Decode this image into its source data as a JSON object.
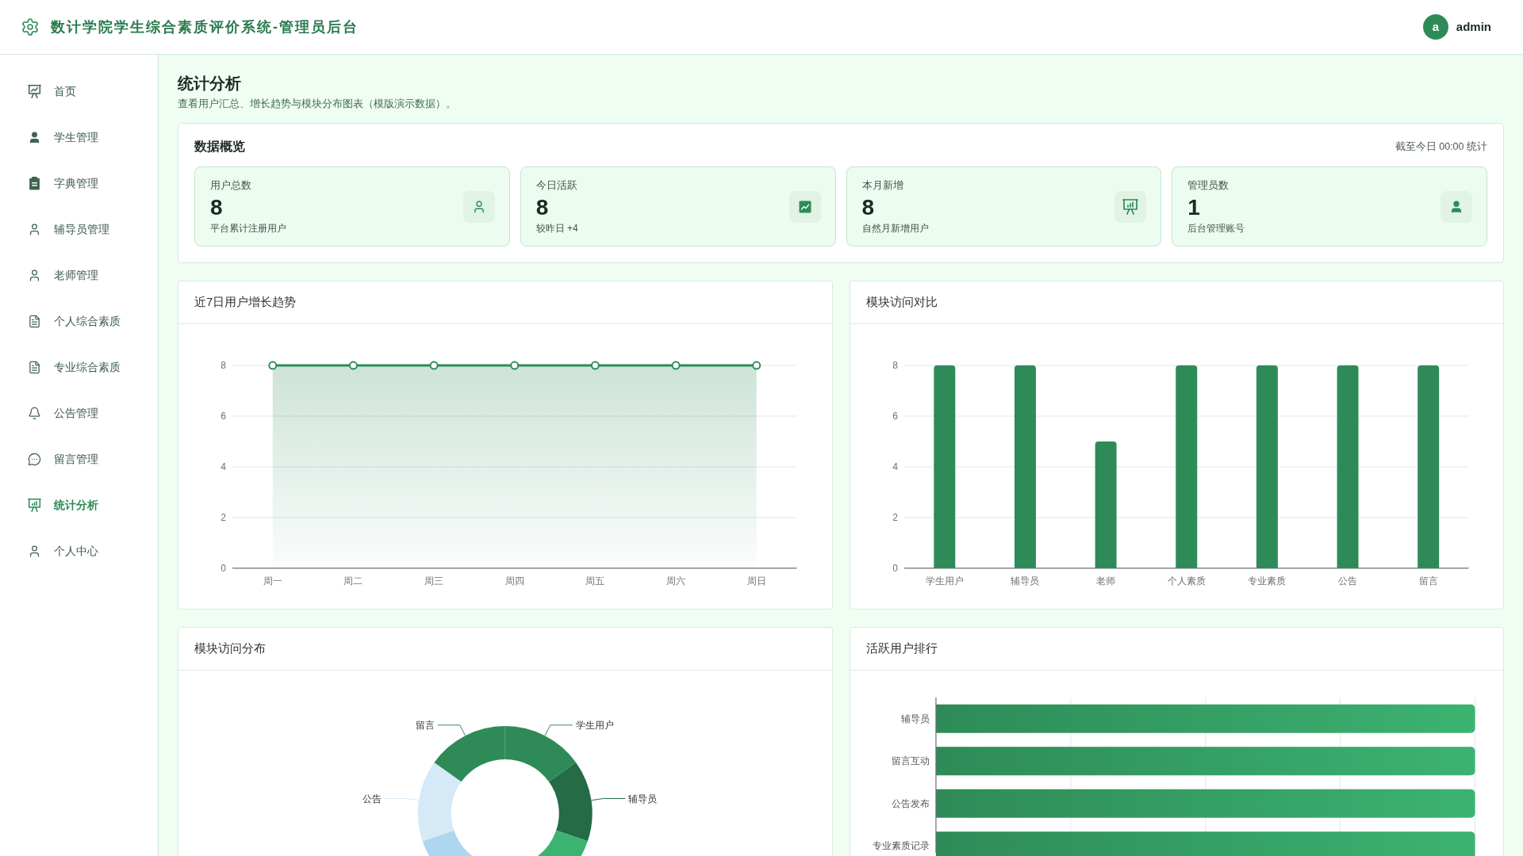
{
  "header": {
    "title": "数计学院学生综合素质评价系统-管理员后台",
    "user": {
      "initial": "a",
      "name": "admin"
    }
  },
  "sidebar": {
    "items": [
      {
        "label": "首页",
        "selected": false
      },
      {
        "label": "学生管理",
        "selected": false
      },
      {
        "label": "字典管理",
        "selected": false
      },
      {
        "label": "辅导员管理",
        "selected": false
      },
      {
        "label": "老师管理",
        "selected": false
      },
      {
        "label": "个人综合素质",
        "selected": false
      },
      {
        "label": "专业综合素质",
        "selected": false
      },
      {
        "label": "公告管理",
        "selected": false
      },
      {
        "label": "留言管理",
        "selected": false
      },
      {
        "label": "统计分析",
        "selected": true
      },
      {
        "label": "个人中心",
        "selected": false
      }
    ]
  },
  "page": {
    "title": "统计分析",
    "subtitle": "查看用户汇总、增长趋势与模块分布图表（模版演示数据）。"
  },
  "overview": {
    "title": "数据概览",
    "note": "截至今日 00:00 统计",
    "stats": [
      {
        "label": "用户总数",
        "value": "8",
        "caption": "平台累计注册用户"
      },
      {
        "label": "今日活跃",
        "value": "8",
        "caption": "较昨日 +4"
      },
      {
        "label": "本月新增",
        "value": "8",
        "caption": "自然月新增用户"
      },
      {
        "label": "管理员数",
        "value": "1",
        "caption": "后台管理账号"
      }
    ]
  },
  "growth_trend": {
    "title": "近7日用户增长趋势",
    "chart_data": {
      "type": "area",
      "categories": [
        "周一",
        "周二",
        "周三",
        "周四",
        "周五",
        "周六",
        "周日"
      ],
      "series": [
        {
          "color": "#2e8b57",
          "values": [
            8,
            8,
            8,
            8,
            8,
            8,
            8
          ]
        }
      ],
      "ylim": [
        0,
        8
      ],
      "yticks": [
        0,
        2,
        4,
        6,
        8
      ],
      "grid": true
    }
  },
  "module_compare": {
    "title": "模块访问对比",
    "chart_data": {
      "type": "bar",
      "categories": [
        "学生用户",
        "辅导员",
        "老师",
        "个人素质",
        "专业素质",
        "公告",
        "留言"
      ],
      "series": [
        {
          "color": "#2e8b57",
          "values": [
            8,
            8,
            5,
            8,
            8,
            8,
            8
          ]
        }
      ],
      "ylim": [
        0,
        8
      ],
      "yticks": [
        0,
        2,
        4,
        6,
        8
      ],
      "grid": true
    }
  },
  "module_distribution": {
    "title": "模块访问分布",
    "slices": [
      {
        "label": "学生用户",
        "color": "#2e8b57"
      },
      {
        "label": "辅导员",
        "color": "#256b45"
      },
      {
        "color": "#3cb371"
      },
      {
        "color": "#aed6f1"
      },
      {
        "label": "公告",
        "color": "#d6e9f7"
      },
      {
        "label": "留言",
        "color": "#2e8b57"
      }
    ]
  },
  "active_ranking": {
    "title": "活跃用户排行",
    "rows": [
      "辅导员",
      "留言互动",
      "公告发布",
      "专业素质记录"
    ]
  }
}
